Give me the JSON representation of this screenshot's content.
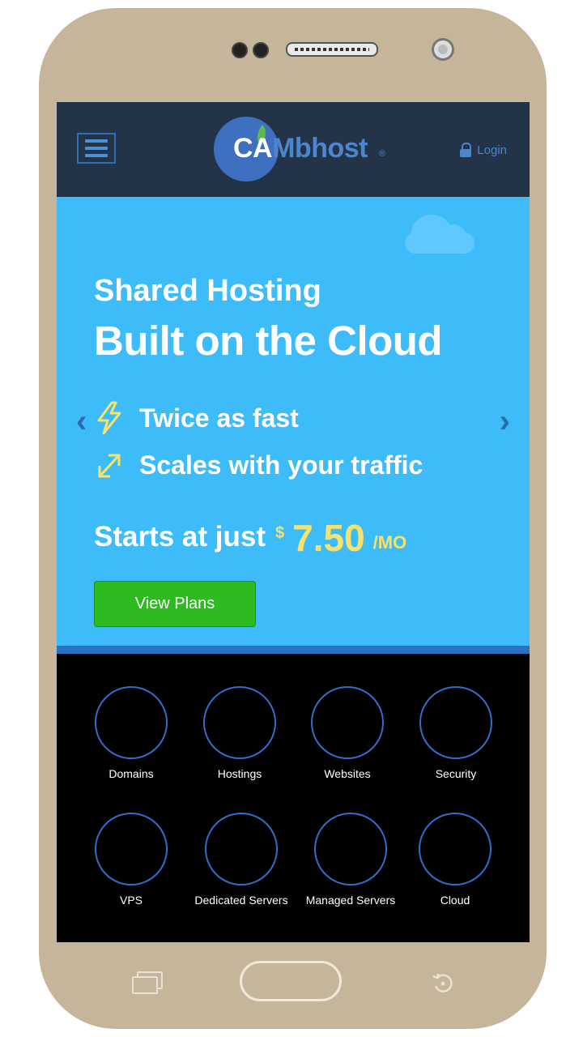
{
  "header": {
    "logo_white": "CA",
    "logo_blue": "Mbhost",
    "logo_reg": "®",
    "login_label": "Login"
  },
  "hero": {
    "title_line1": "Shared Hosting",
    "title_line2": "Built on the Cloud",
    "features": [
      {
        "icon": "lightning-icon",
        "label": "Twice as fast"
      },
      {
        "icon": "expand-arrows-icon",
        "label": "Scales with your traffic"
      }
    ],
    "price_prefix": "Starts at just",
    "price_currency": "$",
    "price_amount": "7.50",
    "price_unit": "/MO",
    "cta_label": "View Plans",
    "prev_arrow": "‹",
    "next_arrow": "›"
  },
  "services": [
    {
      "label": "Domains"
    },
    {
      "label": "Hostings"
    },
    {
      "label": "Websites"
    },
    {
      "label": "Security"
    },
    {
      "label": "VPS"
    },
    {
      "label": "Dedicated Servers"
    },
    {
      "label": "Managed Servers"
    },
    {
      "label": "Cloud"
    }
  ],
  "colors": {
    "header_bg": "#233449",
    "hero_bg": "#3ebcfa",
    "accent_yellow": "#f8e26a",
    "cta_green": "#2dbb1f",
    "brand_blue": "#4b86cf"
  }
}
